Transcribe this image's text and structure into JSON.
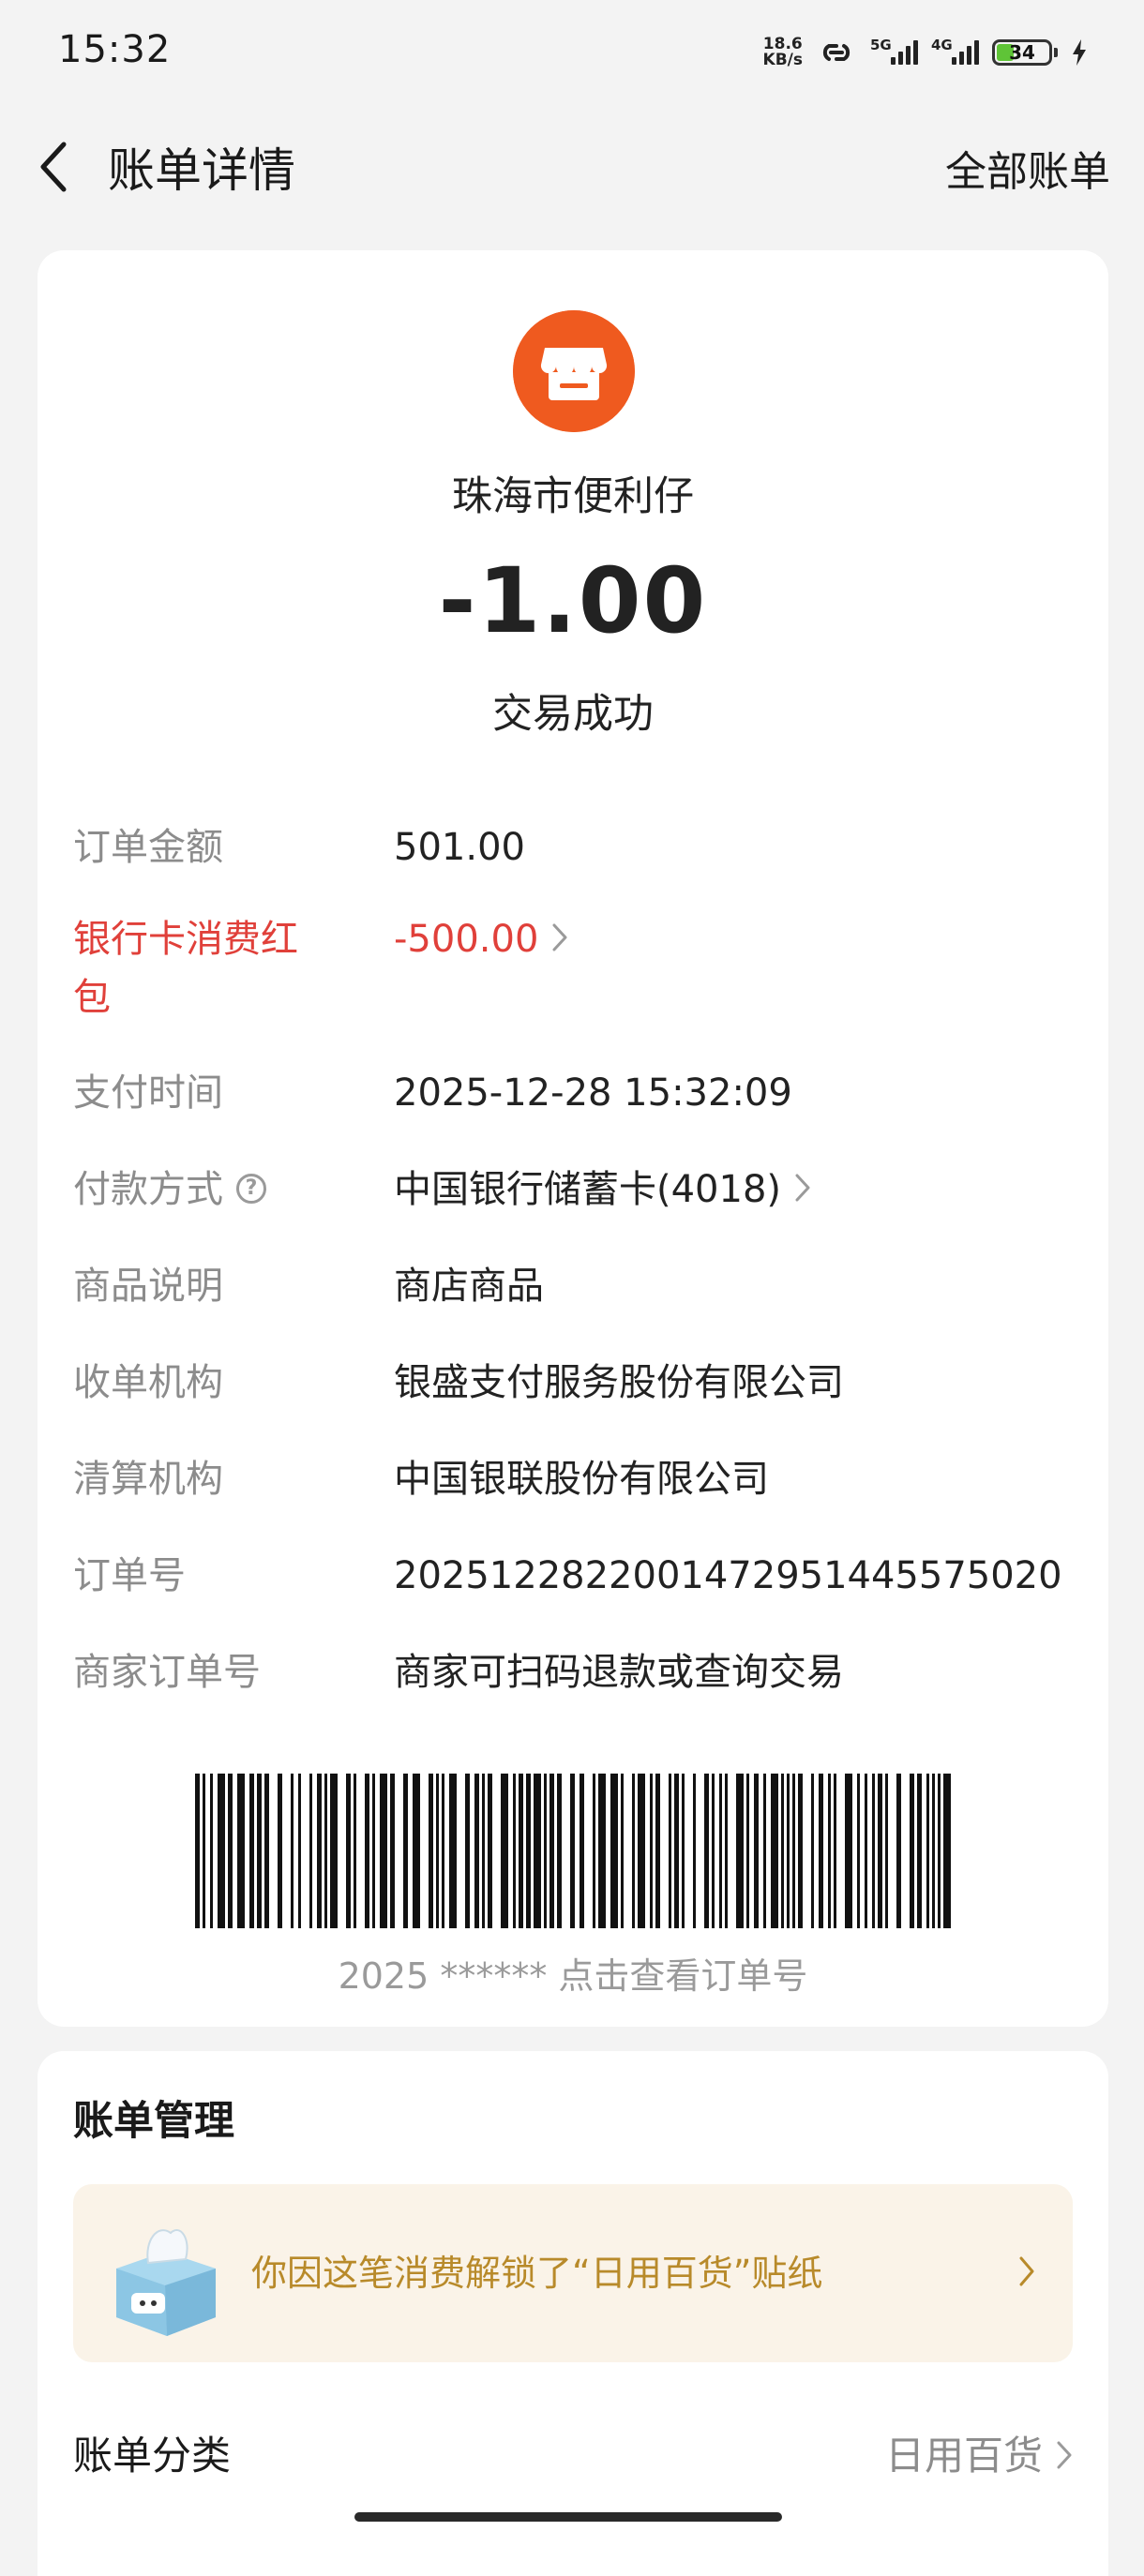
{
  "status_bar": {
    "time": "15:32",
    "net_speed_value": "18.6",
    "net_speed_unit": "KB/s",
    "signal1_label": "5G",
    "signal2_label": "4G",
    "battery_level": "34",
    "battery_fraction": 0.34,
    "icons": [
      "link-icon",
      "signal-icon",
      "battery-icon",
      "charging-icon"
    ]
  },
  "header": {
    "title": "账单详情",
    "all_bills_label": "全部账单",
    "back_icon": "chevron-left-icon"
  },
  "transaction": {
    "merchant_name": "珠海市便利仔",
    "merchant_icon": "store-icon",
    "merchant_icon_color": "#ef5a1f",
    "amount": "-1.00",
    "status": "交易成功"
  },
  "details": [
    {
      "label": "订单金额",
      "value": "501.00"
    },
    {
      "label": "银行卡消费红包",
      "value": "-500.00"
    },
    {
      "label": "支付时间",
      "value": "2025-12-28 15:32:09"
    },
    {
      "label": "付款方式",
      "value": "中国银行储蓄卡(4018)"
    },
    {
      "label": "商品说明",
      "value": "商店商品"
    },
    {
      "label": "收单机构",
      "value": "银盛支付服务股份有限公司"
    },
    {
      "label": "清算机构",
      "value": "中国银联股份有限公司"
    },
    {
      "label": "订单号",
      "value": "2025122822001472951445575020"
    },
    {
      "label": "商家订单号",
      "value": "商家可扫码退款或查询交易"
    }
  ],
  "barcode": {
    "caption": "2025 ****** 点击查看订单号"
  },
  "management": {
    "title": "账单管理",
    "sticker_text": "你因这笔消费解锁了“日用百货”贴纸",
    "category_label": "账单分类",
    "category_value": "日用百货"
  },
  "colors": {
    "accent_red": "#e0403a",
    "sticker_text": "#b88a2a",
    "sticker_bg": "#faf3e8"
  }
}
